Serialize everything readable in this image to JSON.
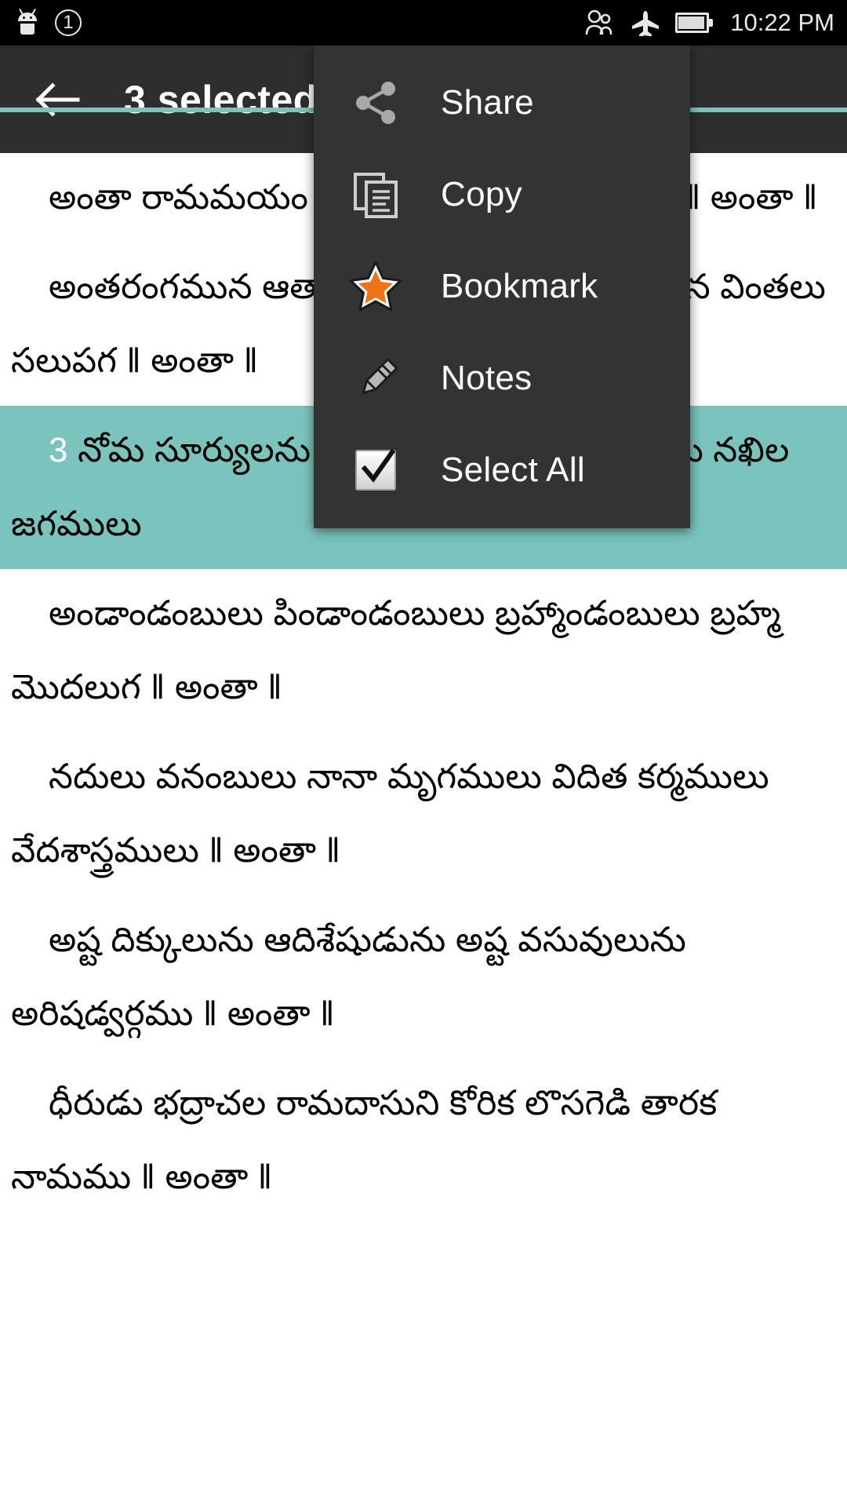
{
  "status_bar": {
    "icons_left": [
      "android-robot-icon",
      "notification-count-badge"
    ],
    "notification_count": "1",
    "icons_right": [
      "people-icon",
      "airplane-mode-icon",
      "battery-icon"
    ],
    "clock": "10:22 PM"
  },
  "app_bar": {
    "back_icon": "back-arrow-icon",
    "title": "3 selected",
    "accent_color": "#7ac4bd",
    "background_color": "#2e2e2e"
  },
  "menu": {
    "background_color": "#333333",
    "items": [
      {
        "label": "Share",
        "icon": "share-icon"
      },
      {
        "label": "Copy",
        "icon": "copy-icon"
      },
      {
        "label": "Bookmark",
        "icon": "star-bookmark-icon"
      },
      {
        "label": "Notes",
        "icon": "pencil-icon"
      },
      {
        "label": "Select All",
        "icon": "checkbox-checked-icon"
      }
    ]
  },
  "content": {
    "selection_highlight_color": "#7ac4bd",
    "paragraphs": [
      {
        "index": "",
        "text": "అంతా రామమయం ఈ జగమంతా రామమయం ‖ అంతా ‖",
        "selected": false
      },
      {
        "index": "",
        "text": "అంతరంగమున ఆత్మారాముడు అనంత రూపమున వింతలు సలుపగ ‖ అంతా ‖",
        "selected": false
      },
      {
        "index": "3",
        "text": "నోమ సూర్యులను నోట నిలువగ మహాంబుధులు నఖిల జగములు",
        "selected": true
      },
      {
        "index": "",
        "text": "అండాండంబులు పిండాండంబులు బ్రహ్మాండంబులు బ్రహ్మ మొదలుగ ‖ అంతా ‖",
        "selected": false
      },
      {
        "index": "",
        "text": "నదులు వనంబులు నానా మృగములు విదిత కర్మములు వేదశాస్త్రములు ‖ అంతా ‖",
        "selected": false
      },
      {
        "index": "",
        "text": "అష్ట దిక్కులును ఆదిశేషుడును అష్ట వసువులును అరిషడ్వర్గము ‖ అంతా ‖",
        "selected": false
      },
      {
        "index": "",
        "text": "ధీరుడు భద్రాచల రామదాసుని కోరిక లొసగెడి తారక నామము ‖ అంతా ‖",
        "selected": false
      }
    ]
  }
}
